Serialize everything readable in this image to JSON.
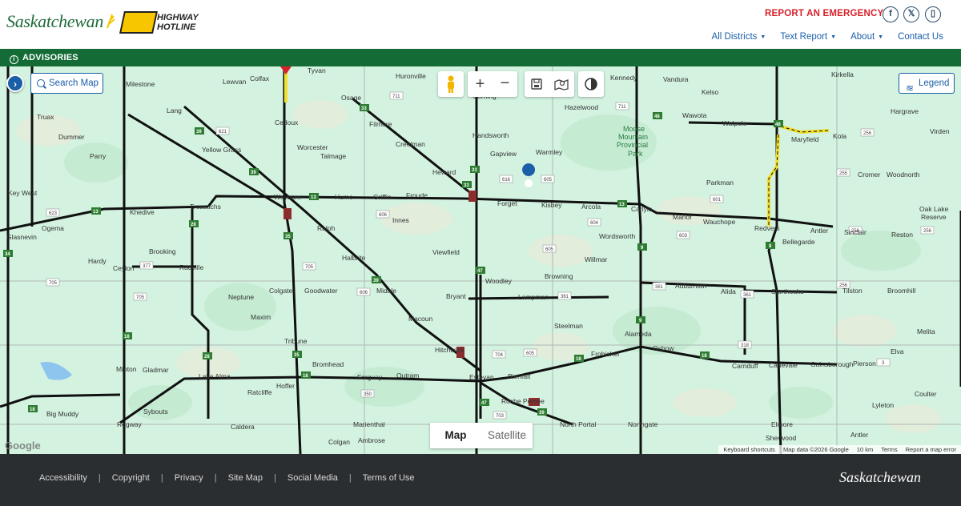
{
  "header": {
    "brand": "Saskatchewan",
    "hotline_line1": "HIGHWAY",
    "hotline_line2": "HOTLINE",
    "report": "REPORT AN EMERGENCY",
    "social": [
      {
        "icon": "facebook-icon",
        "glyph": "f"
      },
      {
        "icon": "x-icon",
        "glyph": "𝕏"
      },
      {
        "icon": "mobile-icon",
        "glyph": "▯"
      }
    ],
    "nav": [
      {
        "label": "All Districts",
        "dropdown": true
      },
      {
        "label": "Text Report",
        "dropdown": true
      },
      {
        "label": "About",
        "dropdown": true
      },
      {
        "label": "Contact Us",
        "dropdown": false
      }
    ]
  },
  "advisories": {
    "label": "ADVISORIES"
  },
  "map": {
    "search_label": "Search Map",
    "legend_label": "Legend",
    "type_map": "Map",
    "type_satellite": "Satellite",
    "google": "Google",
    "attribution": [
      "Keyboard shortcuts",
      "Map data ©2026 Google",
      "10 km",
      "Terms",
      "Report a map error"
    ],
    "places": [
      "Milestone",
      "Lewvan",
      "Tyvan",
      "Huronville",
      "Corning",
      "Kennedy",
      "Vandura",
      "Kirkella",
      "Truax",
      "Colfax",
      "Osage",
      "Hazelwood",
      "Kelso",
      "Hargrave",
      "Lang",
      "Cedoux",
      "Filmore",
      "Handsworth",
      "Wawota",
      "Walpole",
      "Virden",
      "Dummer",
      "Yellow Grass",
      "Worcester",
      "Creelman",
      "Moose",
      "Mountain",
      "Provincial",
      "Park",
      "Maryfield",
      "Kola",
      "Parry",
      "Talmage",
      "Gapview",
      "Warmley",
      "Heward",
      "Cromer",
      "Woodnorth",
      "Key West",
      "Weyburn",
      "Hume",
      "Griffin",
      "Froude",
      "Forget",
      "Kisbey",
      "Arcola",
      "Carlyle",
      "Parkman",
      "Ogema",
      "Khedive",
      "Trossachs",
      "Innes",
      "Manor",
      "Wauchope",
      "Redvers",
      "Antler",
      "Oak Lake",
      "Reserve",
      "Glasnevin",
      "Ralph",
      "Bellegarde",
      "Sinclair",
      "Reston",
      "Brooking",
      "Wordsworth",
      "Hardy",
      "Ceylon",
      "Radville",
      "Halbrite",
      "Viewfield",
      "Willmar",
      "Browning",
      "Woodley",
      "Auburnton",
      "Alida",
      "Storthoaks",
      "Tilston",
      "Broomhill",
      "Neptune",
      "Colgate",
      "Goodwater",
      "Midale",
      "Bryant",
      "Lampman",
      "Steelman",
      "Maxim",
      "Macoun",
      "Alameda",
      "Melita",
      "Tribune",
      "Hitchcock",
      "Frobisher",
      "Oxbow",
      "Elva",
      "Minton",
      "Gladmar",
      "Bromhead",
      "Lake Alma",
      "Forguay",
      "Outram",
      "Estevan",
      "Bienfait",
      "Carnduff",
      "Carievale",
      "Gainsborough",
      "Pierson",
      "Ratcliffe",
      "Hoffer",
      "Coulter",
      "Roche Percee",
      "Lyleton",
      "Big Muddy",
      "Sybouts",
      "Regway",
      "Caldera",
      "Marienthal",
      "North Portal",
      "Northgate",
      "Elmore",
      "Sherwood",
      "Antler",
      "Colgan",
      "Ambrose"
    ]
  },
  "footer": {
    "links": [
      "Accessibility",
      "Copyright",
      "Privacy",
      "Site Map",
      "Social Media",
      "Terms of Use"
    ],
    "brand": "Saskatchewan"
  },
  "colors": {
    "brand_green": "#146b35",
    "emergency_red": "#d6222a",
    "link_blue": "#1a5fa8",
    "map_land": "#d3f2e0",
    "footer_bg": "#2b2e30"
  }
}
